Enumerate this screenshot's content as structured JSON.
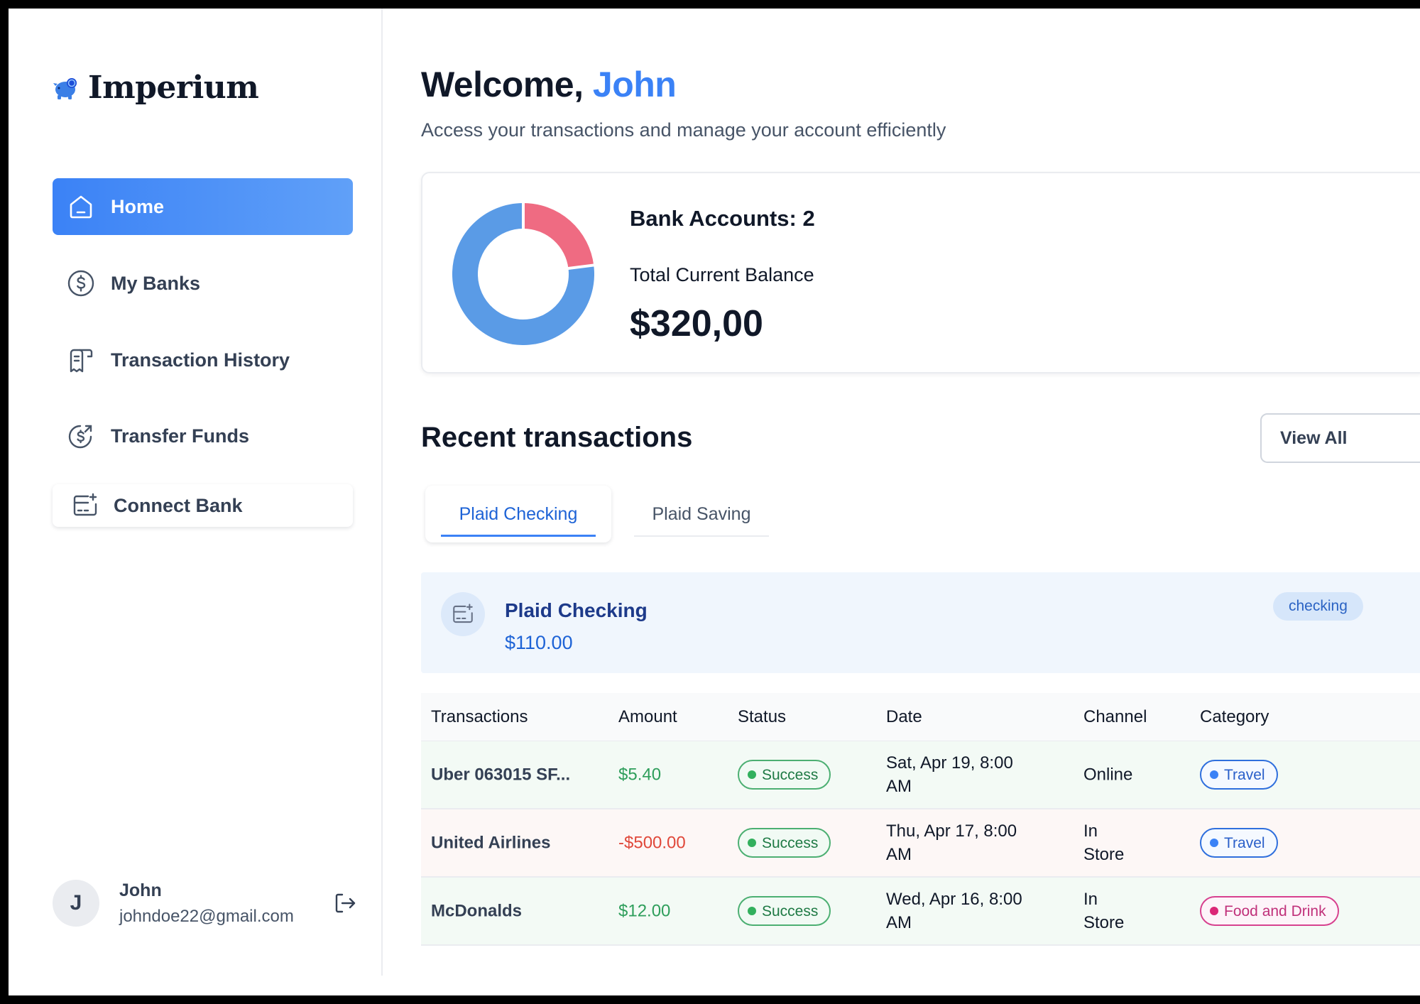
{
  "app": {
    "name": "Imperium"
  },
  "sidebar": {
    "items": [
      {
        "label": "Home",
        "icon": "home-icon",
        "active": true
      },
      {
        "label": "My Banks",
        "icon": "dollar-circle-icon"
      },
      {
        "label": "Transaction History",
        "icon": "receipt-icon"
      },
      {
        "label": "Transfer Funds",
        "icon": "money-send-icon"
      }
    ],
    "connect_bank": "Connect Bank",
    "user": {
      "initial": "J",
      "name": "John",
      "email": "johndoe22@gmail.com"
    }
  },
  "header": {
    "welcome": "Welcome,",
    "name": "John",
    "subtitle": "Access your transactions and manage your account efficiently"
  },
  "balance": {
    "bank_accounts": "Bank Accounts: 2",
    "total_label": "Total Current Balance",
    "total_value": "$320,00",
    "donut": [
      {
        "share": 0.23,
        "color": "#ef6b82"
      },
      {
        "share": 0.77,
        "color": "#5a9be6"
      }
    ]
  },
  "recent": {
    "title": "Recent transactions",
    "view_all": "View All",
    "tabs": [
      "Plaid Checking",
      "Plaid Saving"
    ],
    "account": {
      "name": "Plaid Checking",
      "balance": "$110.00",
      "type": "checking"
    },
    "columns": [
      "Transactions",
      "Amount",
      "Status",
      "Date",
      "Channel",
      "Category"
    ],
    "rows": [
      {
        "name": "Uber 063015 SF...",
        "amount": "$5.40",
        "status": "Success",
        "date": [
          "Sat, Apr 19, 8:00",
          "AM"
        ],
        "channel": [
          "Online",
          ""
        ],
        "category": "Travel"
      },
      {
        "name": "United Airlines",
        "amount": "-$500.00",
        "status": "Success",
        "date": [
          "Thu, Apr 17, 8:00",
          "AM"
        ],
        "channel": [
          "In",
          "Store"
        ],
        "category": "Travel"
      },
      {
        "name": "McDonalds",
        "amount": "$12.00",
        "status": "Success",
        "date": [
          "Wed, Apr 16, 8:00",
          "AM"
        ],
        "channel": [
          "In",
          "Store"
        ],
        "category": "Food and Drink"
      }
    ]
  },
  "colors": {
    "accent": "#3b82f6",
    "positive": "#2e9e5b",
    "negative": "#e0483a"
  }
}
